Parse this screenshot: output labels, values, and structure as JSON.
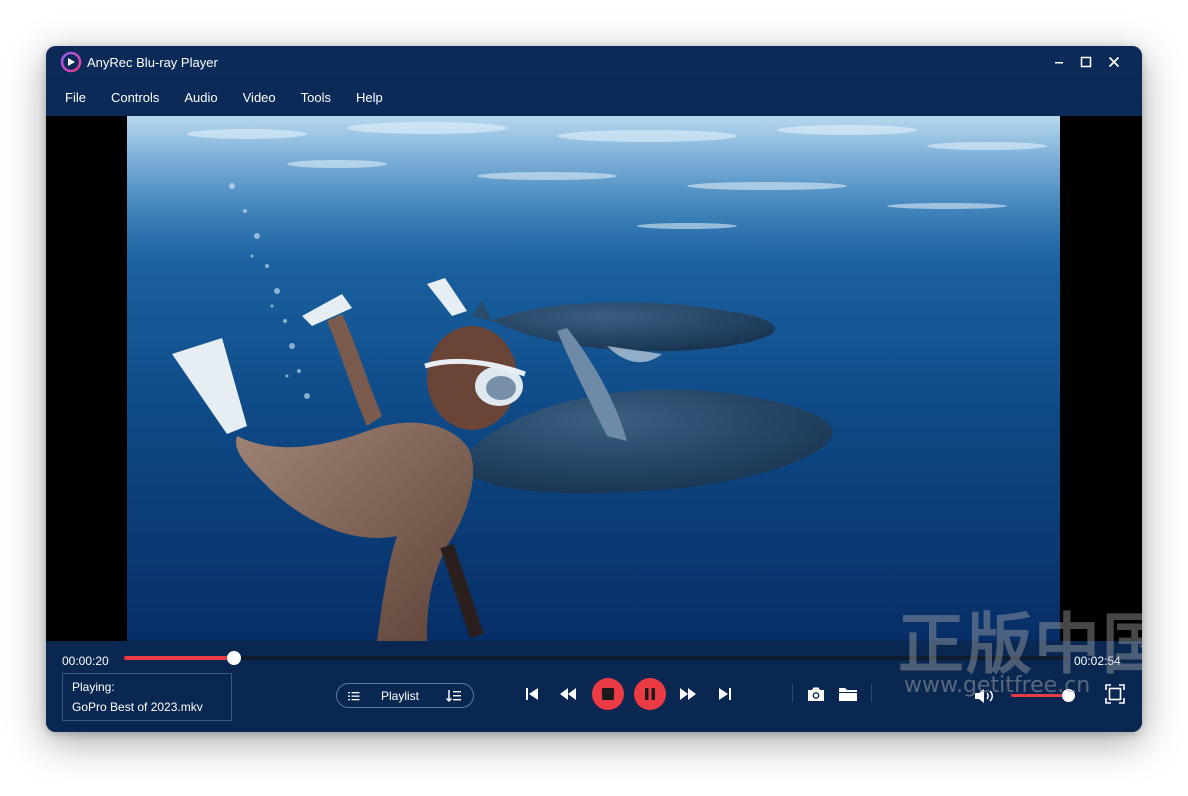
{
  "window": {
    "title": "AnyRec Blu-ray Player"
  },
  "menu": [
    "File",
    "Controls",
    "Audio",
    "Video",
    "Tools",
    "Help"
  ],
  "player": {
    "time_current": "00:00:20",
    "time_total": "00:02:54",
    "progress": 0.116,
    "volume": 0.87,
    "playing_label": "Playing:",
    "file_name": "GoPro Best of 2023.mkv",
    "playlist_label": "Playlist"
  },
  "watermark": {
    "chinese": "正版中国",
    "url": "www.getitfree.cn"
  },
  "colors": {
    "window_bg": "#0a2752",
    "accent": "#ea3b44",
    "water": "#0e4c86"
  },
  "icons": [
    "app-logo-icon",
    "minimize-icon",
    "maximize-icon",
    "close-icon",
    "list-icon",
    "sort-icon",
    "previous-icon",
    "rewind-icon",
    "stop-icon",
    "pause-icon",
    "fast-forward-icon",
    "next-icon",
    "camera-icon",
    "folder-icon",
    "volume-icon",
    "fullscreen-icon"
  ]
}
